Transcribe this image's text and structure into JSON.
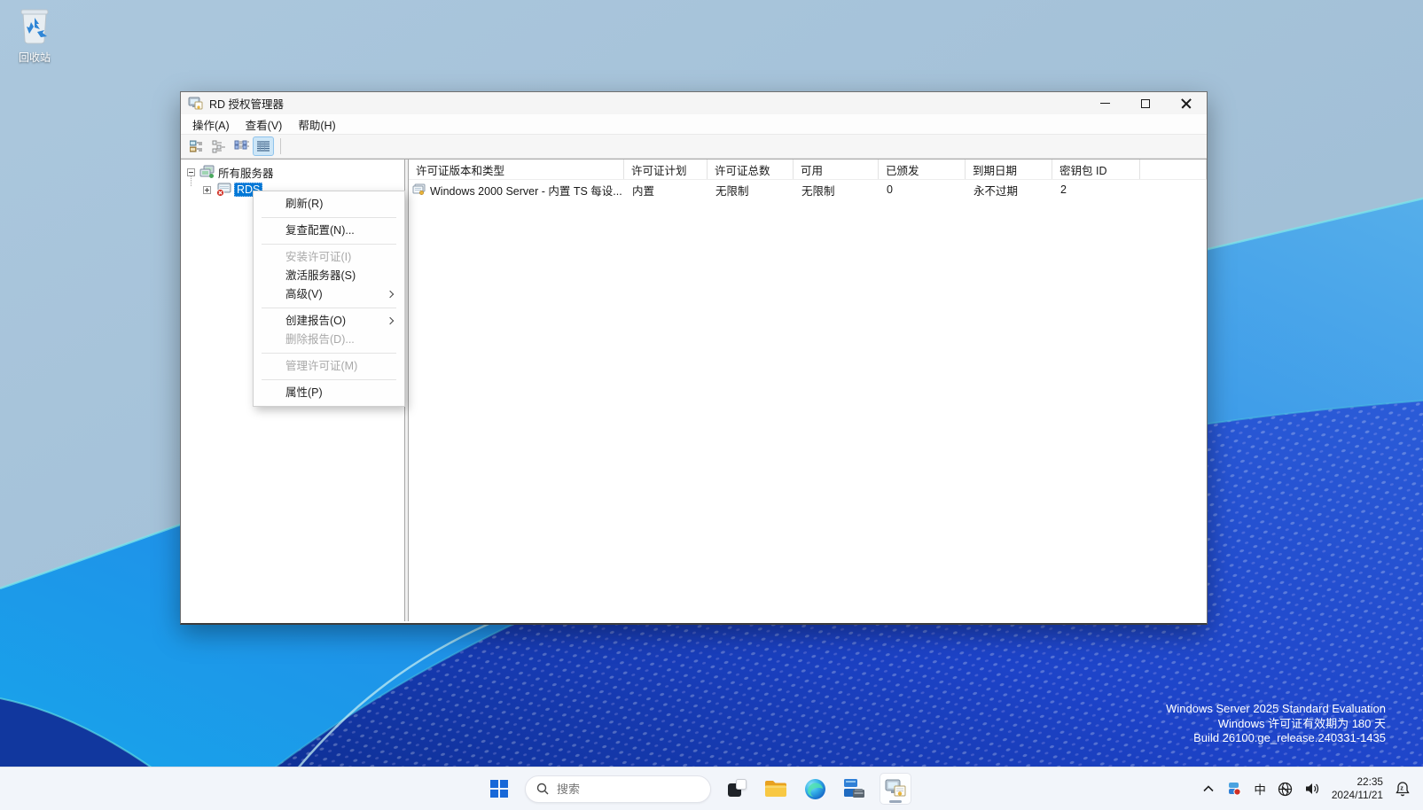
{
  "desktop": {
    "recycle_bin_label": "回收站",
    "watermark": {
      "line1": "Windows Server 2025 Standard Evaluation",
      "line2": "Windows 许可证有效期为 180 天",
      "line3": "Build 26100.ge_release.240331-1435"
    }
  },
  "window": {
    "title": "RD 授权管理器",
    "menus": [
      {
        "label": "操作(A)"
      },
      {
        "label": "查看(V)"
      },
      {
        "label": "帮助(H)"
      }
    ],
    "tree": {
      "root_label": "所有服务器",
      "server_label": "RDS"
    },
    "context_menu": {
      "items": [
        {
          "label": "刷新(R)",
          "enabled": true,
          "submenu": false
        },
        {
          "label": "复查配置(N)...",
          "enabled": true,
          "submenu": false
        },
        {
          "label": "安装许可证(I)",
          "enabled": false,
          "submenu": false
        },
        {
          "label": "激活服务器(S)",
          "enabled": true,
          "submenu": false
        },
        {
          "label": "高级(V)",
          "enabled": true,
          "submenu": true
        },
        {
          "label": "创建报告(O)",
          "enabled": true,
          "submenu": true
        },
        {
          "label": "删除报告(D)...",
          "enabled": false,
          "submenu": false
        },
        {
          "label": "管理许可证(M)",
          "enabled": false,
          "submenu": false
        },
        {
          "label": "属性(P)",
          "enabled": true,
          "submenu": false
        }
      ]
    },
    "table": {
      "columns": [
        "许可证版本和类型",
        "许可证计划",
        "许可证总数",
        "可用",
        "已颁发",
        "到期日期",
        "密钥包 ID"
      ],
      "row": {
        "name": "Windows 2000 Server - 内置 TS 每设...",
        "plan": "内置",
        "total": "无限制",
        "available": "无限制",
        "issued": "0",
        "expiry": "永不过期",
        "keypack_id": "2"
      }
    }
  },
  "taskbar": {
    "search_placeholder": "搜索",
    "tray": {
      "ime_label": "中",
      "time": "22:35",
      "date": "2024/11/21"
    }
  },
  "colors": {
    "selection_blue": "#0078d7",
    "taskbar_bg": "#f2f5fa",
    "wallpaper_light": "#a9c6dc",
    "wallpaper_mid_blue": "#2186e8",
    "wallpaper_deep_blue": "#1d43c8",
    "error_badge_red": "#d03025",
    "toolbar_selected_bg": "#cde6f7"
  },
  "icons": {
    "app": "rd-licensing-app-icon",
    "tray": [
      "chevron-up-icon",
      "server-status-icon",
      "ime-indicator",
      "globe-no-network-icon",
      "speaker-icon",
      "notification-bell-dnd-icon"
    ]
  }
}
